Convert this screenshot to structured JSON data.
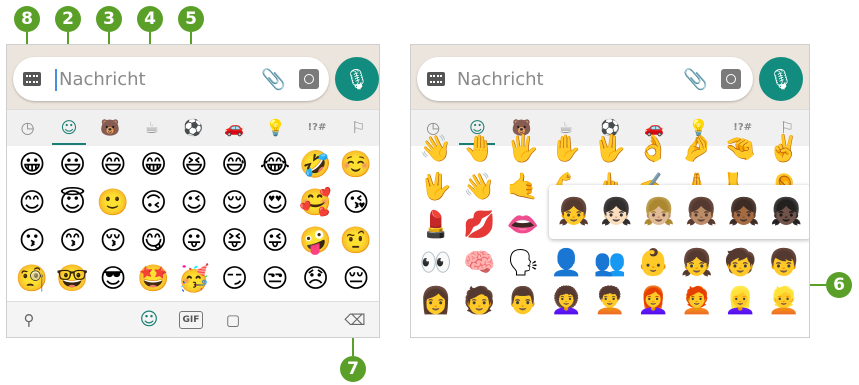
{
  "callouts": [
    "8",
    "2",
    "3",
    "4",
    "5",
    "6",
    "7"
  ],
  "left": {
    "placeholder": "Nachricht",
    "tab_icons": [
      "clock-icon",
      "smiley-icon",
      "bear-icon",
      "cup-icon",
      "ball-icon",
      "car-icon",
      "bulb-icon",
      "symbols-icon",
      "flag-icon"
    ],
    "tab_glyphs": [
      "◷",
      "☺",
      "🐻",
      "☕",
      "⚽",
      "🚗",
      "💡",
      "!?#",
      "⚐"
    ],
    "rows": [
      [
        "😀",
        "😃",
        "😄",
        "😁",
        "😆",
        "😅",
        "😂",
        "🤣",
        "☺️"
      ],
      [
        "😊",
        "😇",
        "🙂",
        "🙃",
        "😉",
        "😌",
        "😍",
        "🥰",
        "😘"
      ],
      [
        "😗",
        "😙",
        "😚",
        "😋",
        "😛",
        "😝",
        "😜",
        "🤪",
        "🤨"
      ],
      [
        "🧐",
        "🤓",
        "😎",
        "🤩",
        "🥳",
        "😏",
        "😒",
        "😞",
        "😔"
      ]
    ],
    "bottom": {
      "search": "⚲",
      "emoji": "☺",
      "gif": "GIF",
      "sticker": "▢",
      "backspace": "⌫"
    }
  },
  "right": {
    "placeholder": "Nachricht",
    "rows": [
      [
        "👋",
        "🤚",
        "🖐",
        "✋",
        "🖖",
        "👌",
        "🤌",
        "🤏",
        "✌️"
      ],
      [
        "🖖",
        "👋",
        "🤙",
        "💪",
        "🖕",
        "✍️",
        "🙏",
        "🦶",
        "👂"
      ],
      [
        "💄",
        "💋",
        "👄",
        "",
        "",
        "",
        "",
        "",
        ""
      ],
      [
        "👀",
        "🧠",
        "🗣",
        "👤",
        "👥",
        "👶",
        "👧",
        "🧒",
        "👦"
      ],
      [
        "👩",
        "🧑",
        "👨",
        "👩‍🦱",
        "🧑‍🦱",
        "👩‍🦰",
        "🧑‍🦰",
        "👱‍♀️",
        "👱"
      ]
    ],
    "popup": [
      "👧",
      "👧🏻",
      "👧🏼",
      "👧🏽",
      "👧🏾",
      "👧🏿"
    ]
  },
  "colors": {
    "accent": "#1a7f72",
    "callout": "#5aa028",
    "mic": "#128c7e"
  }
}
